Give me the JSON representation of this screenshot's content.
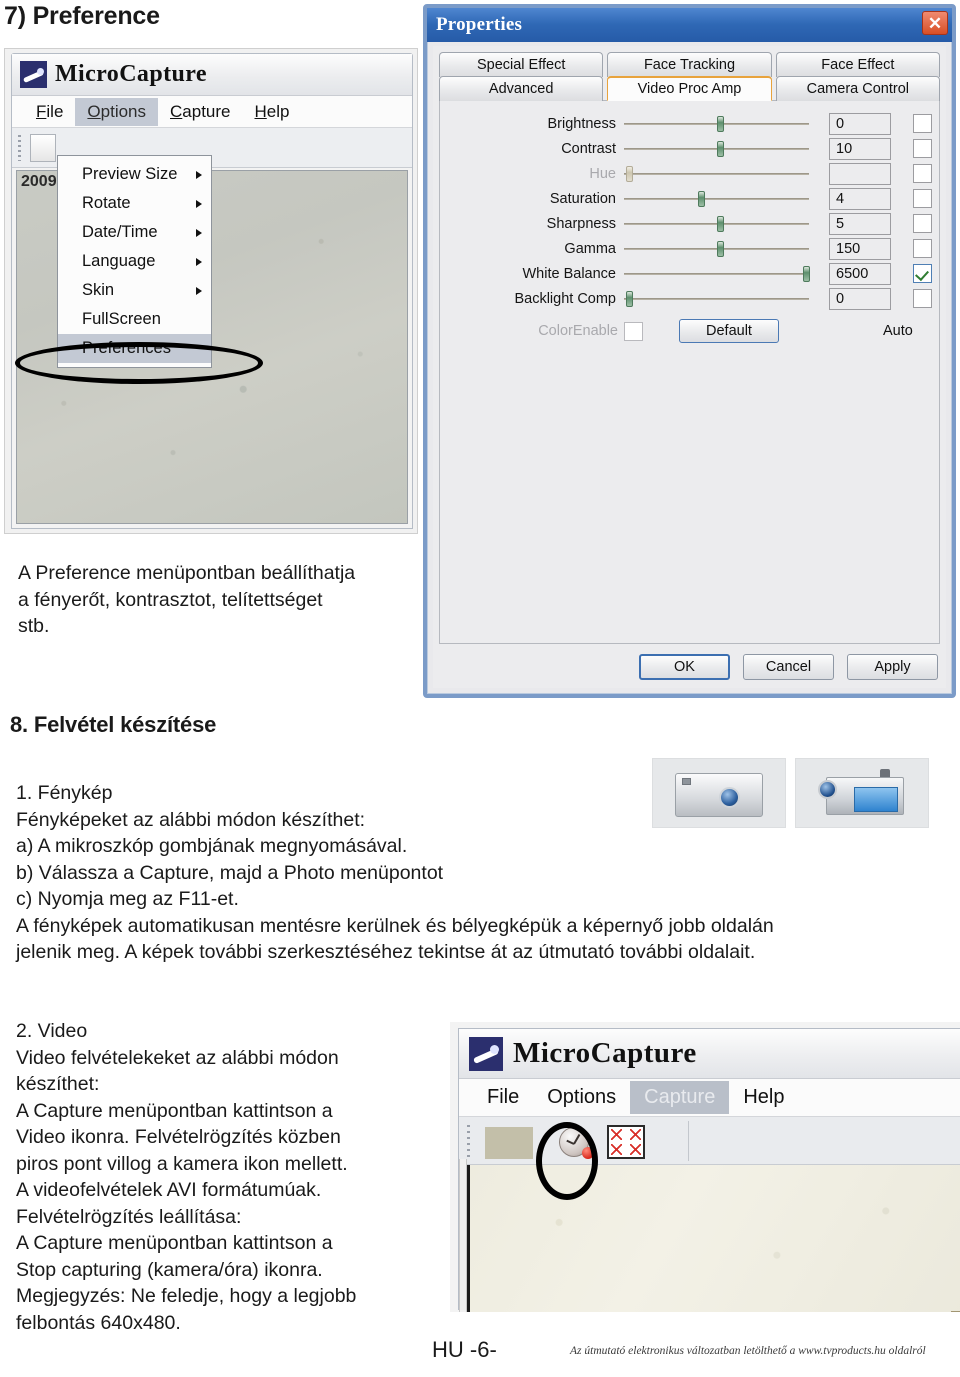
{
  "sections": {
    "pref_heading": "7) Preference",
    "capture_heading": "8. Felvétel készítése"
  },
  "pref_description": "A Preference menüpontban beállíthatja\na fényerőt, kontrasztot, telítettséget\nstb.",
  "photo_block": "1. Fénykép\n    Fényképeket az alábbi módon készíthet:\n    a) A mikroszkóp gombjának megnyomásával.\n    b) Válassza a Capture, majd a Photo menüpontot\n    c) Nyomja meg az F11-et.\n    A fényképek automatikusan mentésre kerülnek és bélyegképük a képernyő jobb oldalán\n    jelenik meg. A képek további szerkesztéséhez tekintse át az útmutató további oldalait.",
  "video_block": "2. Video\n    Video felvételekeket az alábbi módon\n    készíthet:\n    A Capture menüpontban kattintson a\n    Video ikonra. Felvételrögzítés közben\n    piros pont villog a kamera ikon mellett.\n    A videofelvételek AVI formátumúak.\n    Felvételrögzítés leállítása:\n    A Capture menüpontban kattintson a\n    Stop capturing (kamera/óra) ikonra.\n    Megjegyzés: Ne feledje, hogy a legjobb\n    felbontás 640x480.",
  "microcapture_options": {
    "app_title": "MicroCapture",
    "timestamp_overlay": "2009",
    "menu": [
      {
        "label": "File",
        "active": false
      },
      {
        "label": "Options",
        "active": true
      },
      {
        "label": "Capture",
        "active": false
      },
      {
        "label": "Help",
        "active": false
      }
    ],
    "options_menu_items": [
      {
        "label": "Preview Size",
        "submenu": true,
        "selected": false
      },
      {
        "label": "Rotate",
        "submenu": true,
        "selected": false
      },
      {
        "label": "Date/Time",
        "submenu": true,
        "selected": false
      },
      {
        "label": "Language",
        "submenu": true,
        "selected": false
      },
      {
        "label": "Skin",
        "submenu": true,
        "selected": false
      },
      {
        "label": "FullScreen",
        "submenu": false,
        "selected": false
      },
      {
        "label": "Preferences",
        "submenu": false,
        "selected": true
      }
    ]
  },
  "properties_dialog": {
    "title": "Properties",
    "close_icon": "✕",
    "tabs_row1": [
      {
        "label": "Special Effect",
        "active": false
      },
      {
        "label": "Face Tracking",
        "active": false
      },
      {
        "label": "Face Effect",
        "active": false
      }
    ],
    "tabs_row2": [
      {
        "label": "Advanced",
        "active": false
      },
      {
        "label": "Video Proc Amp",
        "active": true
      },
      {
        "label": "Camera Control",
        "active": false
      }
    ],
    "controls": [
      {
        "label": "Brightness",
        "value": "0",
        "pos": 50,
        "auto": false,
        "disabled": false
      },
      {
        "label": "Contrast",
        "value": "10",
        "pos": 50,
        "auto": false,
        "disabled": false
      },
      {
        "label": "Hue",
        "value": "",
        "pos": 1,
        "auto": false,
        "disabled": true
      },
      {
        "label": "Saturation",
        "value": "4",
        "pos": 40,
        "auto": false,
        "disabled": false
      },
      {
        "label": "Sharpness",
        "value": "5",
        "pos": 50,
        "auto": false,
        "disabled": false
      },
      {
        "label": "Gamma",
        "value": "150",
        "pos": 50,
        "auto": false,
        "disabled": false
      },
      {
        "label": "White Balance",
        "value": "6500",
        "pos": 97,
        "auto": true,
        "disabled": false
      },
      {
        "label": "Backlight Comp",
        "value": "0",
        "pos": 1,
        "auto": false,
        "disabled": false
      }
    ],
    "color_enable_label": "ColorEnable",
    "default_button": "Default",
    "auto_column_label": "Auto",
    "buttons": [
      {
        "label": "OK",
        "primary": true
      },
      {
        "label": "Cancel",
        "primary": false
      },
      {
        "label": "Apply",
        "primary": false
      }
    ]
  },
  "microcapture_capture": {
    "app_title": "MicroCapture",
    "menu": [
      {
        "label": "File",
        "active": false
      },
      {
        "label": "Options",
        "active": false
      },
      {
        "label": "Capture",
        "active": true
      },
      {
        "label": "Help",
        "active": false
      }
    ]
  },
  "footer": {
    "page_number": "HU -6-",
    "note": "Az útmutató elektronikus változatban letölthető a www.tvproducts.hu oldalról"
  },
  "colors": {
    "dialog_title_blue": "#2f68b5",
    "tab_accent_orange": "#e8a33d",
    "menu_highlight": "#c3c9d4",
    "slider_thumb_green": "#5d8f6d",
    "record_dot_red": "#d8291c",
    "close_button_red": "#d84f26"
  }
}
